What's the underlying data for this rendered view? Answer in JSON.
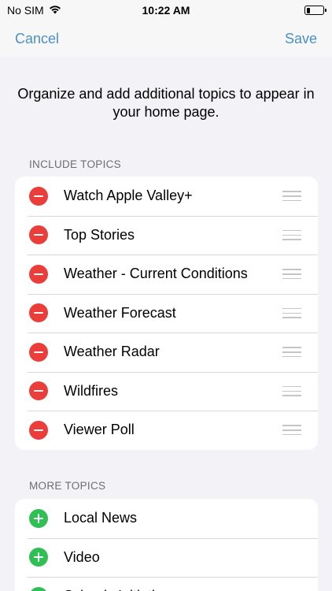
{
  "status_bar": {
    "carrier": "No SIM",
    "time": "10:22 AM",
    "battery_level": 0.2
  },
  "nav": {
    "cancel_label": "Cancel",
    "save_label": "Save"
  },
  "intro_text": "Organize and add additional topics to appear in your home page.",
  "include_section": {
    "header": "INCLUDE TOPICS",
    "items": [
      {
        "label": "Watch Apple Valley+"
      },
      {
        "label": "Top Stories"
      },
      {
        "label": "Weather - Current Conditions"
      },
      {
        "label": "Weather Forecast"
      },
      {
        "label": "Weather Radar"
      },
      {
        "label": "Wildfires"
      },
      {
        "label": "Viewer Poll"
      }
    ]
  },
  "more_section": {
    "header": "MORE TOPICS",
    "items": [
      {
        "label": "Local News"
      },
      {
        "label": "Video"
      },
      {
        "label": "Schools Initiative"
      }
    ]
  },
  "colors": {
    "accent": "#4a90c9",
    "remove": "#eb3d3a",
    "add": "#2fbf55",
    "background": "#f2f2f7"
  }
}
